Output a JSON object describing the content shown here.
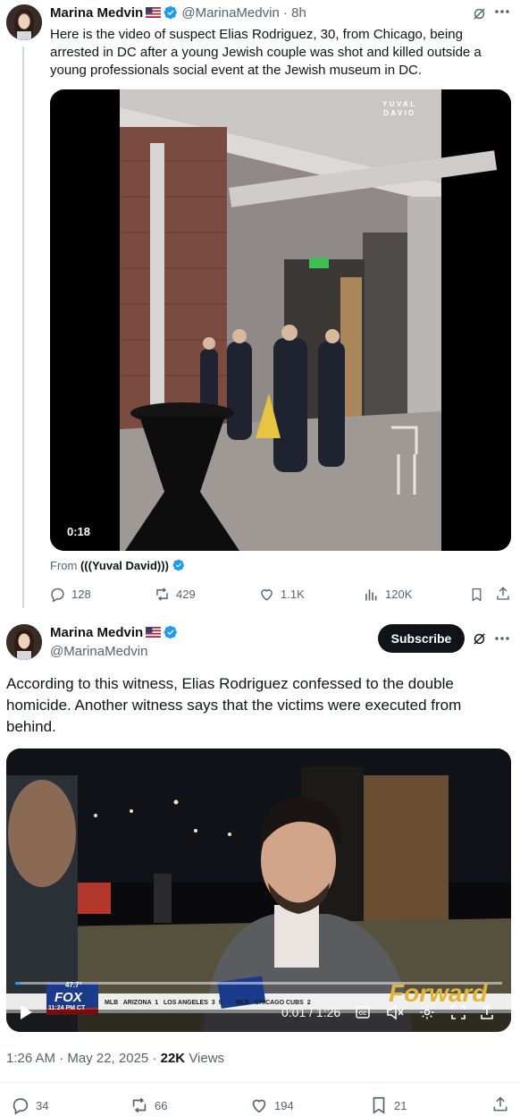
{
  "tweet1": {
    "author_name": "Marina Medvin",
    "handle": "@MarinaMedvin",
    "time": "8h",
    "separator": "·",
    "text": "Here is the video of suspect Elias Rodriguez, 30, from Chicago, being arrested in DC after a young Jewish couple was shot and killed outside a young professionals social event at the Jewish museum in DC.",
    "video": {
      "watermark_line1": "YUVAL",
      "watermark_line2": "DAVID",
      "duration": "0:18"
    },
    "from_label": "From",
    "from_name": "(((Yuval David)))",
    "actions": {
      "replies": "128",
      "reposts": "429",
      "likes": "1.1K",
      "views": "120K"
    }
  },
  "tweet2": {
    "author_name": "Marina Medvin",
    "handle": "@MarinaMedvin",
    "subscribe_label": "Subscribe",
    "text": "According to this witness, Elias Rodriguez confessed to the double homicide. Another witness says that the victims were executed from behind.",
    "video": {
      "channel_bug": "FOX",
      "temp": "47.7°",
      "clock": "11:24 PM CT",
      "ticker": "MLB   ARIZONA  1   LOS ANGELES  3  9        MLB   CHICAGO CUBS  2",
      "watermark": "Forward",
      "time_display": "0:01 / 1:26",
      "progress_fraction": 0.01
    },
    "timestamp": "1:26 AM · May 22, 2025",
    "views_count": "22K",
    "views_label": "Views",
    "actions": {
      "replies": "34",
      "reposts": "66",
      "likes": "194",
      "bookmarks": "21"
    }
  },
  "colors": {
    "accent": "#1d9bf0",
    "text": "#0f1419",
    "muted": "#536471",
    "line": "#cfd9de"
  }
}
